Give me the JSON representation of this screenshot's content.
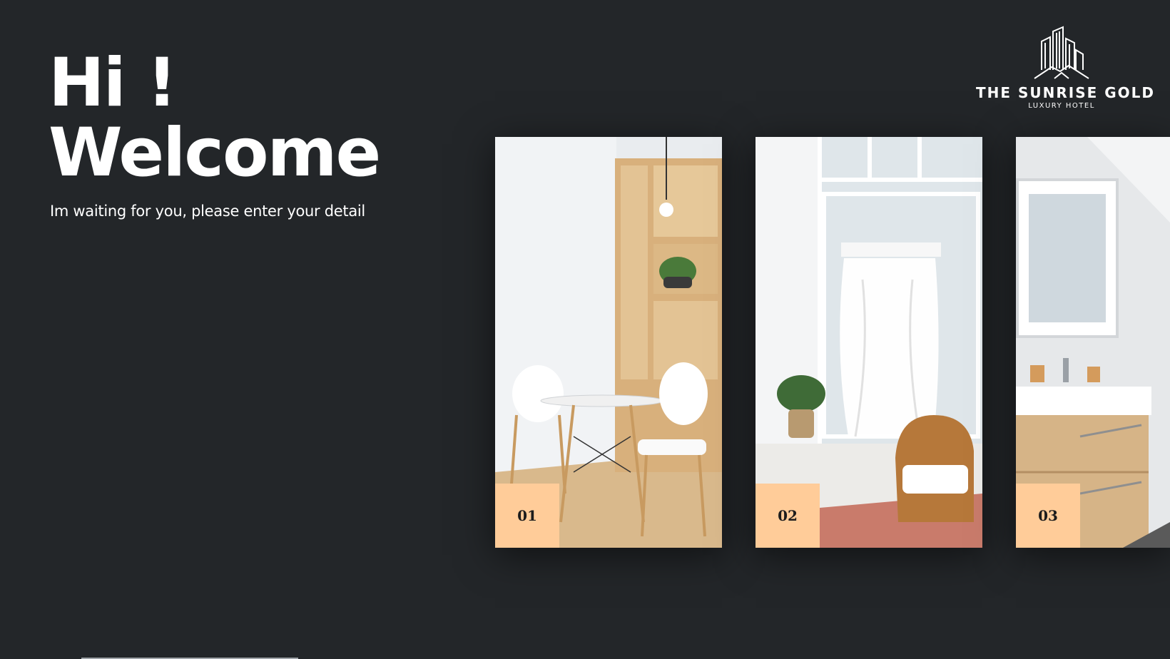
{
  "greeting": {
    "line1": "Hi !",
    "line2": "Welcome"
  },
  "subtitle": "Im waiting for you, please enter your detail",
  "logo": {
    "brand": "THE SUNRISE GOLD",
    "tagline": "LUXURY HOTEL",
    "icon": "building-skyline-icon"
  },
  "rooms": [
    {
      "number": "01",
      "scene": "dining-nook"
    },
    {
      "number": "02",
      "scene": "lounge-chair"
    },
    {
      "number": "03",
      "scene": "bathroom-vanity"
    }
  ],
  "colors": {
    "background": "#232629",
    "badge": "#ffcc99",
    "text": "#ffffff"
  }
}
